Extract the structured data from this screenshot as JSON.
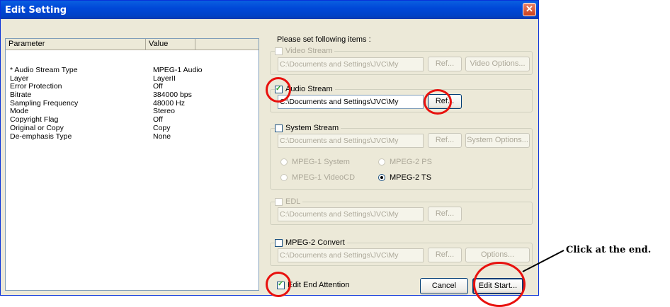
{
  "window": {
    "title": "Edit Setting",
    "close_glyph": "✕"
  },
  "param_table": {
    "headers": [
      "Parameter",
      "Value"
    ],
    "rows": [
      {
        "name": "* Audio Stream Type",
        "value": "MPEG-1 Audio"
      },
      {
        "name": "Layer",
        "value": "LayerII"
      },
      {
        "name": "Error Protection",
        "value": "Off"
      },
      {
        "name": "Bitrate",
        "value": "384000 bps"
      },
      {
        "name": "Sampling Frequency",
        "value": "48000 Hz"
      },
      {
        "name": "Mode",
        "value": "Stereo"
      },
      {
        "name": "Copyright Flag",
        "value": "Off"
      },
      {
        "name": "Original or Copy",
        "value": "Copy"
      },
      {
        "name": "De-emphasis Type",
        "value": "None"
      }
    ]
  },
  "prompt": "Please set following items :",
  "video_stream": {
    "label": "Video Stream",
    "checked": false,
    "path": "C:\\Documents and Settings\\JVC\\My",
    "ref_label": "Ref...",
    "options_label": "Video Options..."
  },
  "audio_stream": {
    "label": "Audio Stream",
    "checked": true,
    "path": "C:\\Documents and Settings\\JVC\\My",
    "ref_label": "Ref..."
  },
  "system_stream": {
    "label": "System Stream",
    "checked": false,
    "path": "C:\\Documents and Settings\\JVC\\My",
    "ref_label": "Ref...",
    "options_label": "System Options...",
    "radios": [
      "MPEG-1 System",
      "MPEG-2 PS",
      "MPEG-1 VideoCD",
      "MPEG-2 TS"
    ],
    "selected": "MPEG-2 TS"
  },
  "edl": {
    "label": "EDL",
    "checked": false,
    "path": "C:\\Documents and Settings\\JVC\\My",
    "ref_label": "Ref..."
  },
  "mpeg2_convert": {
    "label": "MPEG-2 Convert",
    "checked": false,
    "path": "C:\\Documents and Settings\\JVC\\My",
    "ref_label": "Ref...",
    "options_label": "Options..."
  },
  "footer": {
    "edit_end_attention_label": "Edit End Attention",
    "edit_end_attention_checked": true,
    "cancel_label": "Cancel",
    "edit_start_label": "Edit Start..."
  },
  "annotation": {
    "callout_text": "Click at the end.",
    "highlight_color": "#e8110e"
  }
}
